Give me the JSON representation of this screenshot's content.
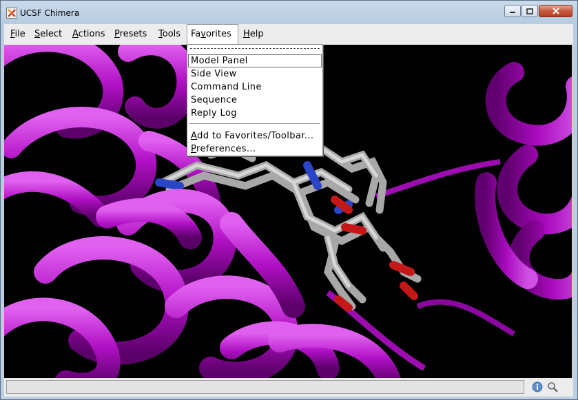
{
  "window": {
    "title": "UCSF Chimera"
  },
  "menubar": {
    "items": [
      {
        "pre": "",
        "u": "F",
        "post": "ile"
      },
      {
        "pre": "",
        "u": "S",
        "post": "elect"
      },
      {
        "pre": "",
        "u": "A",
        "post": "ctions"
      },
      {
        "pre": "",
        "u": "P",
        "post": "resets"
      },
      {
        "pre": "",
        "u": "T",
        "post": "ools"
      },
      {
        "pre": "Fa",
        "u": "v",
        "post": "orites"
      },
      {
        "pre": "",
        "u": "H",
        "post": "elp"
      }
    ]
  },
  "favorites_menu": {
    "items": [
      {
        "pre": "Model Panel",
        "u": "",
        "post": ""
      },
      {
        "pre": "Side View",
        "u": "",
        "post": ""
      },
      {
        "pre": "Command Line",
        "u": "",
        "post": ""
      },
      {
        "pre": "Sequence",
        "u": "",
        "post": ""
      },
      {
        "pre": "Reply Log",
        "u": "",
        "post": ""
      },
      {
        "pre": "",
        "u": "A",
        "post": "dd to Favorites/Toolbar..."
      },
      {
        "pre": "",
        "u": "P",
        "post": "references..."
      }
    ]
  },
  "statusbar": {
    "message": ""
  },
  "icons": {
    "app": "chimera-icon",
    "info": "info-icon",
    "search": "magnifier-icon"
  },
  "colors": {
    "ribbon": "#b010c4",
    "carbon": "#bdbdbd",
    "nitrogen": "#2a45c8",
    "oxygen": "#c41818",
    "background": "#000000"
  }
}
